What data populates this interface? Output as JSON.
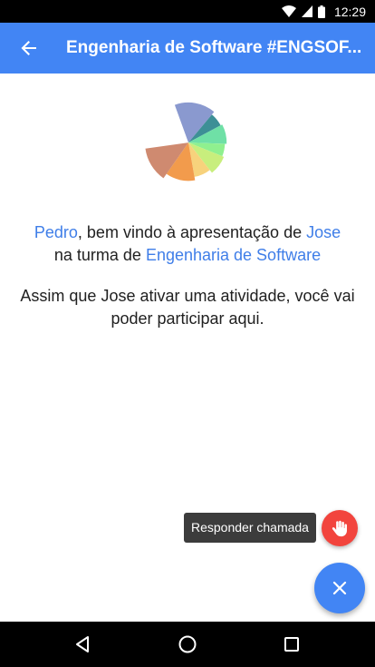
{
  "status_bar": {
    "time": "12:29",
    "icons": [
      "wifi-icon",
      "signal-icon",
      "battery-icon"
    ]
  },
  "app_bar": {
    "back_icon": "arrow-back-icon",
    "title": "Engenharia de Software #ENGSOF..."
  },
  "welcome": {
    "user": "Pedro",
    "text1": ", bem vindo à apresentação de ",
    "presenter": "Jose",
    "text2": "na turma de ",
    "class_name": "Engenharia de Software"
  },
  "waiting_message": "Assim que Jose ativar uma atividade, você vai poder participar aqui.",
  "tooltip": {
    "label": "Responder chamada"
  },
  "fab_small_icon": "hand-icon",
  "fab_icon": "close-icon",
  "nav_bar": {
    "icons": [
      "back-triangle-icon",
      "home-circle-icon",
      "recents-square-icon"
    ]
  },
  "colors": {
    "primary": "#4285f4",
    "accent_text": "#3f7ee8",
    "fab_red": "#f2443d",
    "tooltip_bg": "#3c3c3c",
    "logo_slices": [
      "#8a99cf",
      "#3d8f96",
      "#6fe0a6",
      "#8ff08f",
      "#c8ee7d",
      "#f7d27c",
      "#f29b4c",
      "#cf8a70"
    ]
  }
}
